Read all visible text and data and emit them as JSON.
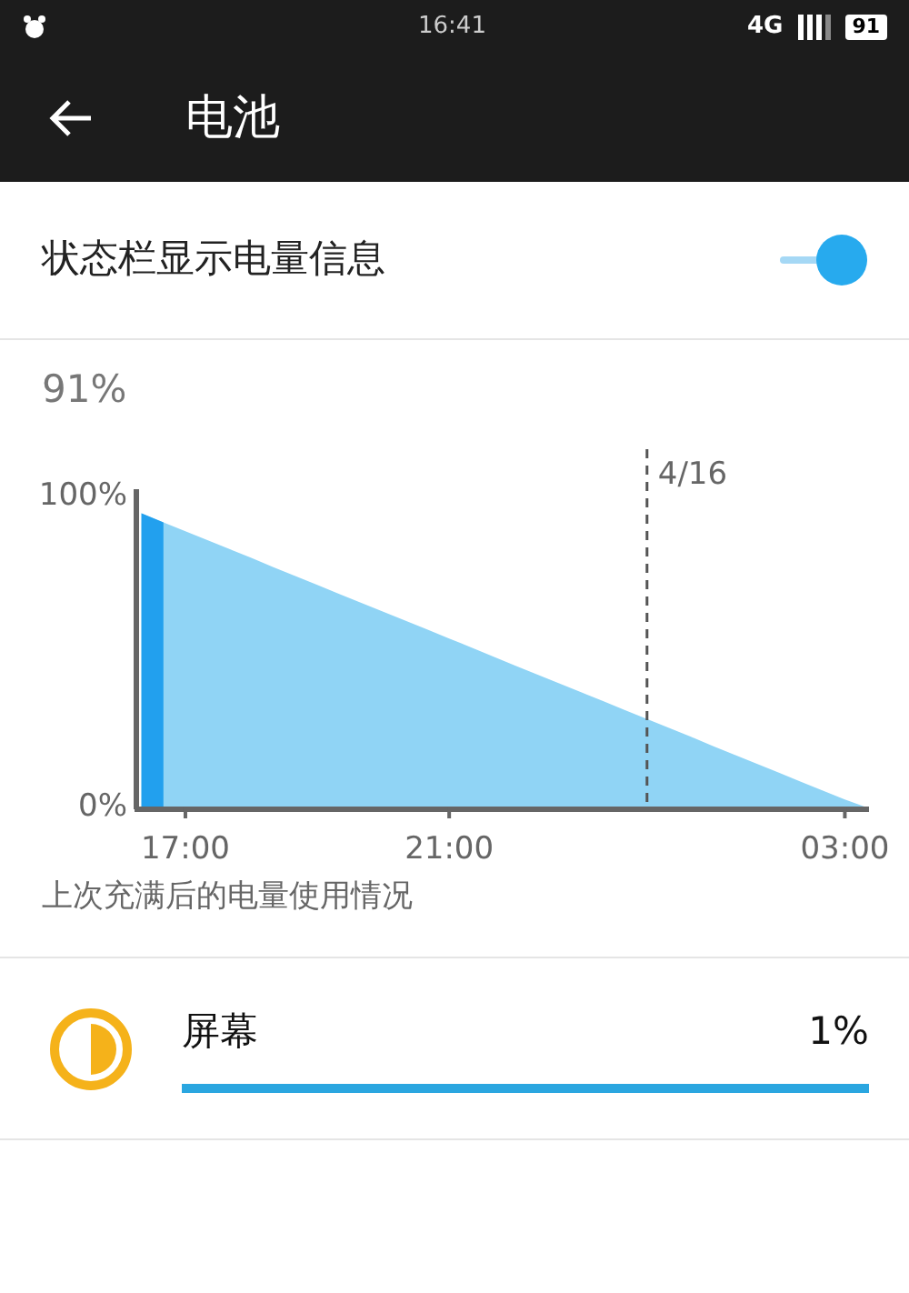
{
  "status_bar": {
    "time": "16:41",
    "network": "4G",
    "battery": "91"
  },
  "header": {
    "title": "电池"
  },
  "toggle_row": {
    "label": "状态栏显示电量信息",
    "on": true
  },
  "battery_level": "91%",
  "chart": {
    "chart_data": {
      "type": "area",
      "categories": [
        null,
        null,
        "17:00",
        null,
        null,
        null,
        null,
        null,
        null,
        null,
        null,
        null,
        null,
        null,
        "21:00",
        null,
        null,
        null,
        null,
        null,
        null,
        null,
        null,
        null,
        null,
        null,
        null,
        null,
        null,
        null,
        null,
        null,
        "03:00",
        null
      ],
      "series": [
        {
          "color": "#90d4f5",
          "values": [
            92.4,
            89.6,
            86.8,
            84.0,
            81.2,
            78.4,
            75.5,
            72.7,
            69.9,
            67.1,
            64.3,
            61.5,
            58.7,
            55.9,
            53.1,
            50.3,
            47.4,
            44.6,
            41.8,
            39.0,
            36.2,
            33.4,
            30.6,
            27.8,
            25.0,
            22.2,
            19.3,
            16.5,
            13.7,
            10.9,
            8.1,
            5.3,
            2.5,
            0
          ]
        },
        {
          "color": "#22a0ee",
          "values": [
            92.4,
            89.6,
            null,
            null,
            null,
            null,
            null,
            null,
            null,
            null,
            null,
            null,
            null,
            null,
            null,
            null,
            null,
            null,
            null,
            null,
            null,
            null,
            null,
            null,
            null,
            null,
            null,
            null,
            null,
            null,
            null,
            null,
            null,
            null
          ]
        }
      ],
      "ylim": [
        0,
        100
      ],
      "yticks": [
        {
          "value": 0,
          "label": "0%"
        },
        {
          "value": 100,
          "label": "100%"
        }
      ]
    },
    "date_marker": "4/16"
  },
  "caption": "上次充满后的电量使用情况",
  "usage": [
    {
      "name": "屏幕",
      "percent": "1%",
      "level": 1
    }
  ]
}
